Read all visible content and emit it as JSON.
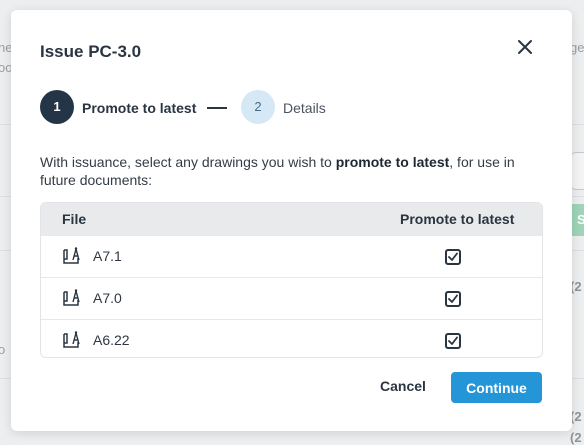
{
  "background": {
    "left_fragments": [
      "ne",
      "oo",
      "o"
    ],
    "right_fragments": [
      "ge",
      "S",
      "(2",
      "(2",
      "(2"
    ]
  },
  "modal": {
    "title": "Issue PC-3.0",
    "close_icon": "close-icon"
  },
  "stepper": {
    "steps": [
      {
        "number": "1",
        "label": "Promote to latest",
        "active": true
      },
      {
        "number": "2",
        "label": "Details",
        "active": false
      }
    ]
  },
  "description": {
    "prefix": "With issuance, select any drawings you wish to ",
    "emphasis": "promote to latest",
    "suffix": ", for use in future documents:"
  },
  "table": {
    "headers": {
      "file": "File",
      "promote": "Promote to latest"
    },
    "rows": [
      {
        "file": "A7.1",
        "icon": "drawing-file-icon",
        "checked": true
      },
      {
        "file": "A7.0",
        "icon": "drawing-file-icon",
        "checked": true
      },
      {
        "file": "A6.22",
        "icon": "drawing-file-icon",
        "checked": true
      }
    ]
  },
  "footer": {
    "cancel_label": "Cancel",
    "continue_label": "Continue"
  },
  "colors": {
    "accent": "#2496d8",
    "dark": "#253548",
    "step_inactive": "#d5e8f5"
  }
}
